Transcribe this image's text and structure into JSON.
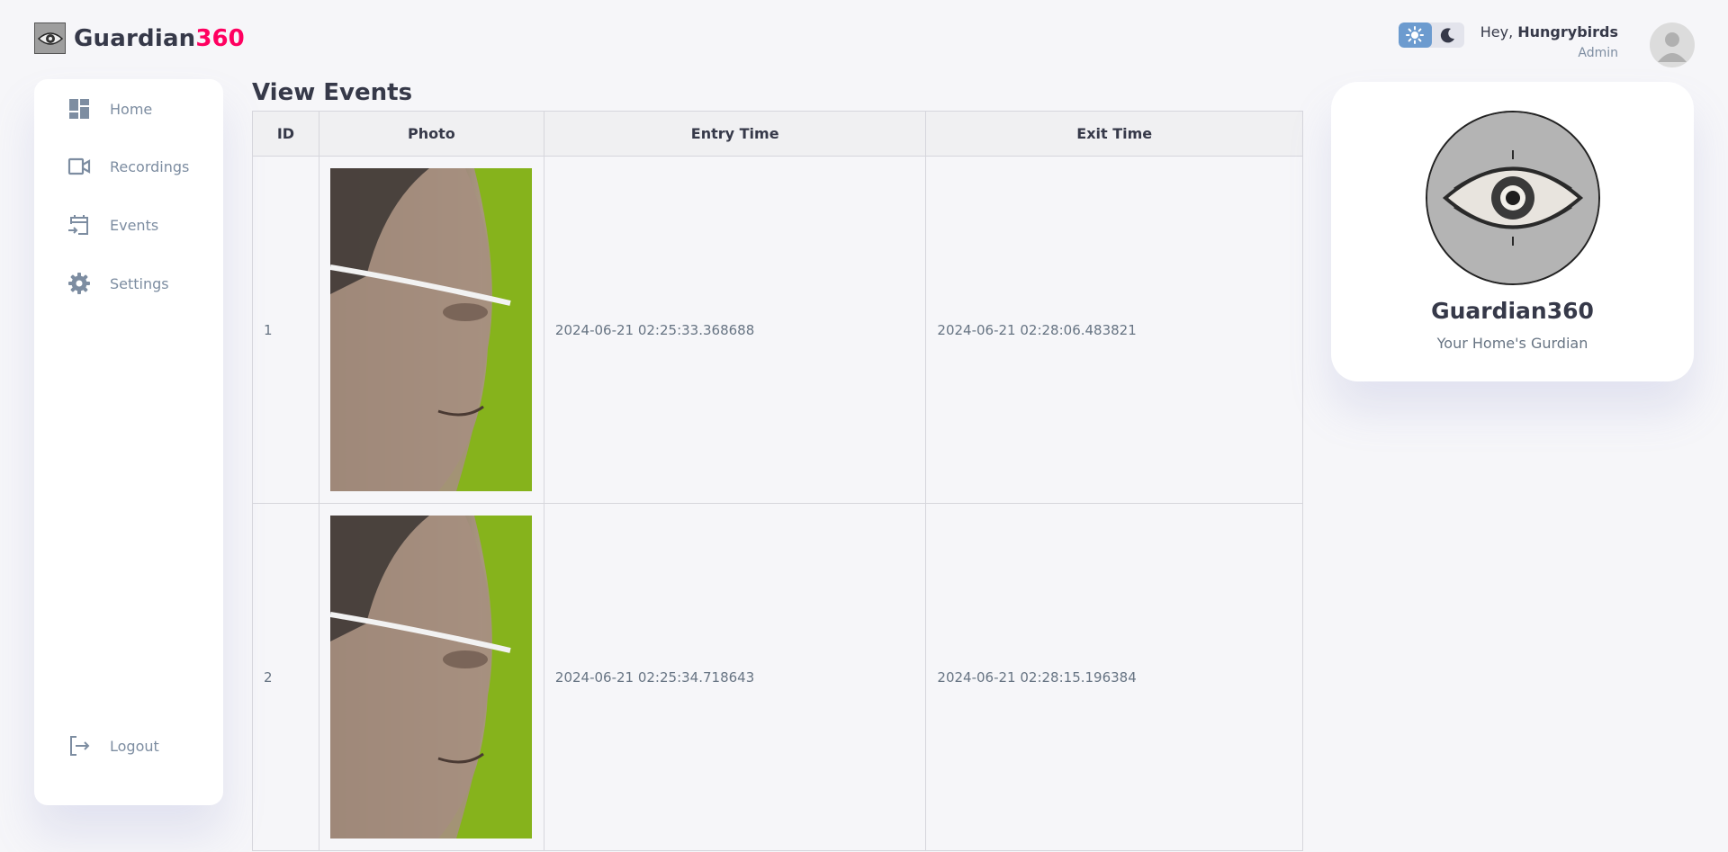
{
  "brand": {
    "name": "Guardian",
    "accent": "360",
    "logo_icon": "eye-icon"
  },
  "theme": {
    "light_icon": "sun-icon",
    "dark_icon": "moon-icon",
    "active": "light"
  },
  "user": {
    "greeting": "Hey, ",
    "name": "Hungrybirds",
    "role": "Admin"
  },
  "sidebar": {
    "items": [
      {
        "label": "Home",
        "icon": "dashboard-icon"
      },
      {
        "label": "Recordings",
        "icon": "video-camera-icon"
      },
      {
        "label": "Events",
        "icon": "calendar-entry-icon"
      },
      {
        "label": "Settings",
        "icon": "gear-icon"
      }
    ],
    "logout": {
      "label": "Logout",
      "icon": "logout-icon"
    }
  },
  "main": {
    "title": "View Events",
    "columns": [
      "ID",
      "Photo",
      "Entry Time",
      "Exit Time"
    ],
    "rows": [
      {
        "id": "1",
        "entry": "2024-06-21 02:25:33.368688",
        "exit": "2024-06-21 02:28:06.483821"
      },
      {
        "id": "2",
        "entry": "2024-06-21 02:25:34.718643",
        "exit": "2024-06-21 02:28:15.196384"
      }
    ]
  },
  "profile": {
    "name": "Guardian360",
    "tagline": "Your Home's Gurdian"
  },
  "colors": {
    "accent": "#ff0060",
    "primary": "#6c9bcf",
    "background": "#f6f6f9",
    "text": "#363949",
    "muted": "#7d8da1"
  }
}
